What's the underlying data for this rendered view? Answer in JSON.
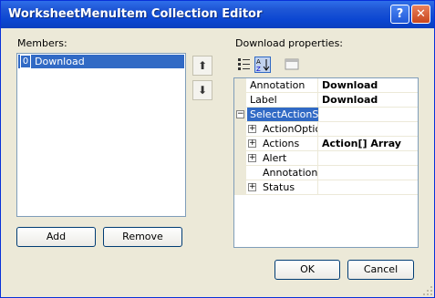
{
  "window": {
    "title": "WorksheetMenuItem Collection Editor"
  },
  "titlebar": {
    "help_glyph": "?",
    "close_glyph": "✕"
  },
  "members": {
    "label": "Members:",
    "items": [
      {
        "index": "0",
        "name": "Download"
      }
    ]
  },
  "arrows": {
    "up_glyph": "⬆",
    "down_glyph": "⬇"
  },
  "buttons": {
    "add": "Add",
    "remove": "Remove",
    "ok": "OK",
    "cancel": "Cancel"
  },
  "properties": {
    "label": "Download properties:",
    "rows": [
      {
        "name": "Annotation",
        "value": "Download",
        "expander": "",
        "indent": false,
        "selected": false
      },
      {
        "name": "Label",
        "value": "Download",
        "expander": "",
        "indent": false,
        "selected": false
      },
      {
        "name": "SelectActionSe",
        "value": "",
        "expander": "−",
        "indent": false,
        "selected": true
      },
      {
        "name": "ActionOptior",
        "value": "",
        "expander": "+",
        "indent": true,
        "selected": false
      },
      {
        "name": "Actions",
        "value": "Action[] Array",
        "expander": "+",
        "indent": true,
        "selected": false
      },
      {
        "name": "Alert",
        "value": "",
        "expander": "+",
        "indent": true,
        "selected": false
      },
      {
        "name": "Annotation",
        "value": "",
        "expander": "",
        "indent": true,
        "selected": false
      },
      {
        "name": "Status",
        "value": "",
        "expander": "+",
        "indent": true,
        "selected": false
      }
    ]
  },
  "colors": {
    "title_bar": "#0b46d1",
    "selection": "#316ac5",
    "dialog_bg": "#ece9d8"
  }
}
